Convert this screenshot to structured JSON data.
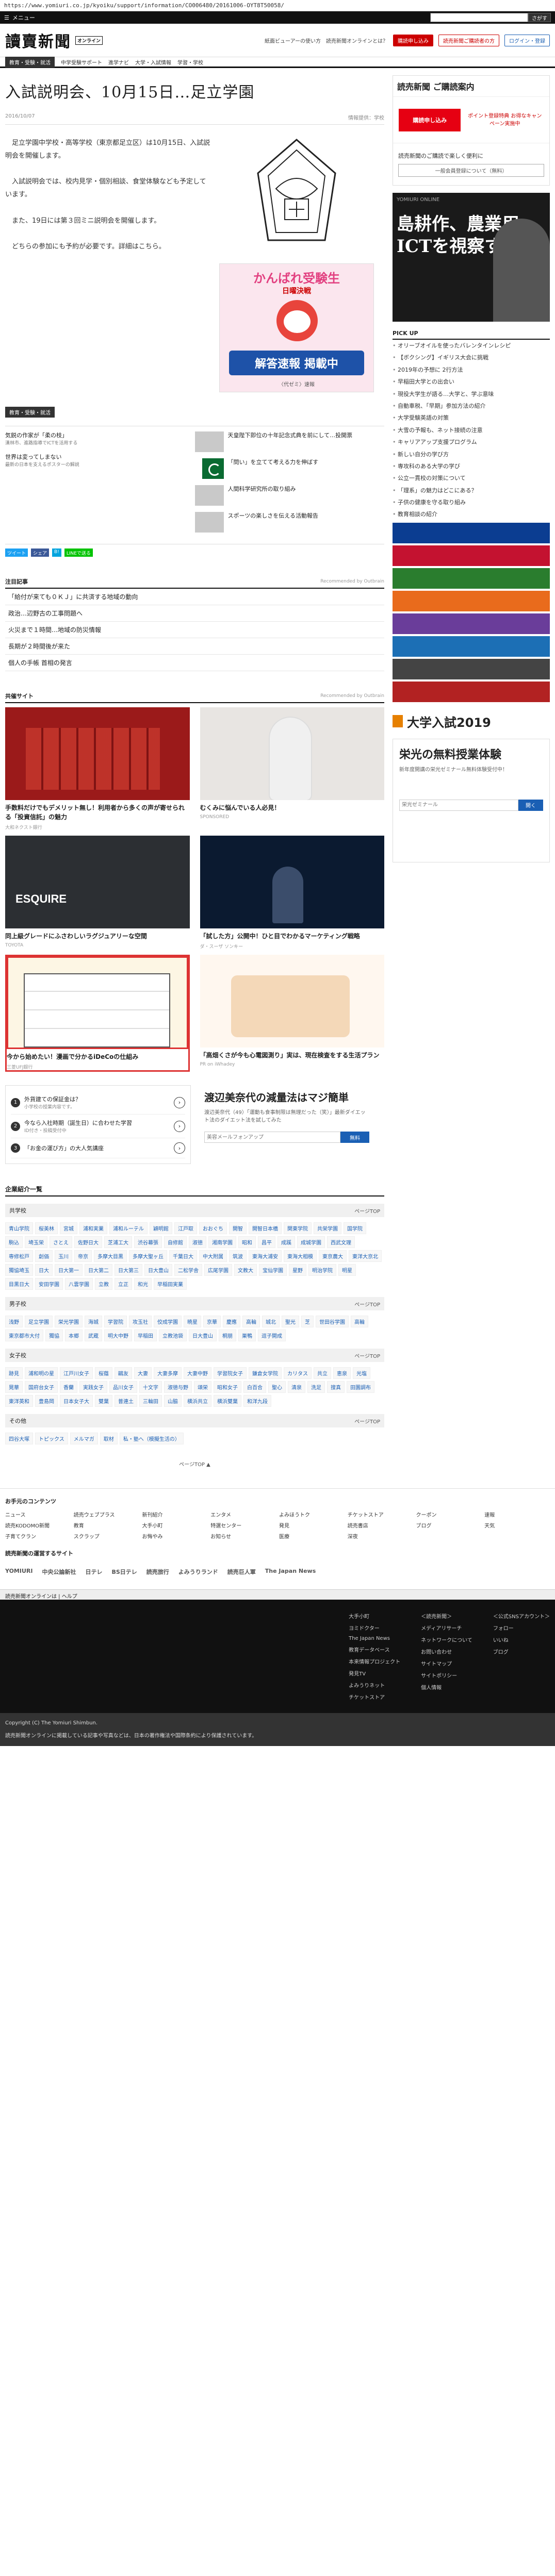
{
  "browser": {
    "url": "https://www.yomiuri.co.jp/kyoiku/support/information/CO006480/20161006-OYT8T50058/"
  },
  "topbar": {
    "menu_label": "メニュー",
    "search_placeholder": "",
    "search_button": "さがす"
  },
  "header": {
    "logo": "讀賣新聞",
    "logo_badge": "オンライン",
    "links": [
      "紙面ビューアーの使い方",
      "読売新聞オンラインとは？"
    ],
    "subscribe_button": "購読申し込み",
    "register_button": "読売新聞ご購読者の方",
    "login_button": "ログイン・登録"
  },
  "catnav": {
    "items": [
      "教育・受験・就活",
      "中学受験サポート",
      "進学ナビ",
      "大学・入試情報",
      "学習・学校"
    ],
    "active": 0
  },
  "article": {
    "title": "入試説明会、10月15日…足立学園",
    "date": "2016/10/07",
    "tools": "情報提供：学校",
    "paragraphs": [
      "足立学園中学校・高等学校（東京都足立区）は10月15日、入試説明会を開催します。",
      "入試説明会では、校内見学・個別相談、食堂体験なども予定しています。",
      "また、19日には第３回ミニ説明会を開催します。",
      "どちらの参加にも予約が必要です。詳細はこちら。"
    ],
    "link_text": "こちら",
    "tag": "教育・受験・就活"
  },
  "ad_kanbare": {
    "title": "かんばれ受験生",
    "sub": "日曜決戦",
    "badge": "解答速報 掲載中",
    "note": "〈代ゼミ〉速報"
  },
  "related": {
    "left": [
      {
        "title": "気鋭の作家が「柔の枝」",
        "small": "漢林市、進路指導でICTを活用する"
      },
      {
        "title": "世界は変ってしまない",
        "small": "最新の日本を支えるポスターの解説"
      }
    ],
    "right": [
      {
        "title": "天皇陛下即位の十年記念式典を前にして…投開票"
      },
      {
        "title": "「問い」を立てて考える力を伸ばす"
      },
      {
        "title": "人間科学研究所の取り組み"
      },
      {
        "title": "スポーツの楽しさを伝える活動報告"
      }
    ]
  },
  "shares": [
    "ツイート",
    "シェア",
    "B!",
    "LINEで送る"
  ],
  "noteworthy": {
    "heading": "注目記事",
    "sub": "Recommended by Outbrain",
    "items": [
      "「給付が来ても０ＫＪ」に共済する地域の動向",
      "政治…辺野古の工事問題へ",
      "火災まで１時間…地域の防災情報",
      "長期が２時間後が来た",
      "個人の手帳 首相の発言"
    ]
  },
  "sponsored": {
    "heading": "共催サイト",
    "sub": "Recommended by Outbrain",
    "cards": [
      {
        "cap": "手数料だけでもデメリット無し！利用者から多くの声が寄せられる「投資信託」の魅力",
        "src": "大和ネクスト銀行"
      },
      {
        "cap": "むくみに悩んでいる人必見！",
        "src": "SPONSORED"
      },
      {
        "cap": "同上級グレードにふさわしいラグジュアリーな空間",
        "src": "TOYOTA"
      },
      {
        "cap": "「試した方」公開中！ひと目でわかるマーケティング戦略",
        "src": "ダ・スーザ ソンキー"
      },
      {
        "cap": "今から始めたい！漫画で分かるiDeCoの仕組み",
        "src": "三菱UFJ銀行"
      },
      {
        "cap": "「高畑くさが今も心電図測り」実は、現在検査をする生活プラン",
        "src": "PR on iWhadey"
      }
    ]
  },
  "quiz": {
    "items": [
      {
        "q": "外貨建ての保証金は？",
        "note": "小学校の授業内容です。"
      },
      {
        "q": "今なら入社時期（誕生日）に合わせた学習",
        "note": "ID付き・投稿受付中"
      },
      {
        "q": "「お金の運び方」の大人気講座",
        "note": ""
      }
    ]
  },
  "magazine": {
    "title": "渡辺美奈代の減量法はマジ簡単",
    "desc": "渡辺美奈代（49）「運動も食事制限は無理だった（笑）」最新ダイエット法のダイエット法を試してみた",
    "placeholder": "美容メールフォンアップ",
    "button": "無料"
  },
  "enterprise": {
    "heading": "企業紹介一覧",
    "groups": [
      {
        "title": "共学校",
        "more": "ページTOP",
        "items": [
          "青山学院",
          "桜美林",
          "宮城",
          "浦和実業",
          "浦和ルーテル",
          "穎明館",
          "江戸取",
          "おおぐち",
          "開智",
          "開智日本橋",
          "関東学院",
          "共栄学園",
          "国学院",
          "駒込",
          "埼玉栄",
          "さとえ",
          "佐野日大",
          "芝浦工大",
          "渋谷幕張",
          "自修館",
          "淑徳",
          "湘南学園",
          "昭和",
          "昌平",
          "成蹊",
          "成城学園",
          "西武文理",
          "専修松戸",
          "創価",
          "玉川",
          "帝京",
          "多摩大目黒",
          "多摩大聖ヶ丘",
          "千葉日大",
          "中大附属",
          "筑波",
          "東海大浦安",
          "東海大相模",
          "東京農大",
          "東洋大京北",
          "獨協埼玉",
          "日大",
          "日大第一",
          "日大第二",
          "日大第三",
          "日大豊山",
          "二松学舎",
          "広尾学園",
          "文教大",
          "宝仙学園",
          "星野",
          "明治学院",
          "明星",
          "目黒日大",
          "安田学園",
          "八雲学園",
          "立教",
          "立正",
          "和光",
          "早稲田実業"
        ]
      },
      {
        "title": "男子校",
        "more": "ページTOP",
        "items": [
          "浅野",
          "足立学園",
          "栄光学園",
          "海城",
          "学習院",
          "攻玉社",
          "佼成学園",
          "暁星",
          "京華",
          "慶應",
          "高輪",
          "城北",
          "聖光",
          "芝",
          "世田谷学園",
          "高輪",
          "東京都市大付",
          "獨協",
          "本郷",
          "武蔵",
          "明大中野",
          "早稲田",
          "立教池袋",
          "日大豊山",
          "桐朋",
          "巣鴨",
          "逗子開成"
        ]
      },
      {
        "title": "女子校",
        "more": "ページTOP",
        "items": [
          "跡見",
          "浦和明の星",
          "江戸川女子",
          "桜蔭",
          "鷗友",
          "大妻",
          "大妻多摩",
          "大妻中野",
          "学習院女子",
          "鎌倉女学院",
          "カリタス",
          "共立",
          "恵泉",
          "光塩",
          "晃華",
          "国府台女子",
          "香蘭",
          "実践女子",
          "品川女子",
          "十文字",
          "淑徳与野",
          "頌栄",
          "昭和女子",
          "白百合",
          "聖心",
          "清泉",
          "洗足",
          "搜真",
          "田園調布",
          "東洋英和",
          "豊島岡",
          "日本女子大",
          "雙葉",
          "普連土",
          "三輪田",
          "山脇",
          "横浜共立",
          "横浜雙葉",
          "和洋九段"
        ]
      },
      {
        "title": "その他",
        "more": "ページTOP",
        "items": [
          "四谷大塚",
          "トピックス",
          "メルマガ",
          "取材",
          "私・塾へ（模擬生活の）"
        ]
      }
    ]
  },
  "pagetop": "ページTOP ▲",
  "side": {
    "reg_title": "読売新聞 ご購読案内",
    "reg_btn1": "購読申し込み",
    "reg_btn2": "ポイント登録特典 お得なキャンペーン実施中",
    "sub_text": "読売新聞のご購読で楽しく便利に",
    "sub_pill": "一般会員登録について（無料）",
    "ad_big": "島耕作、農業用ICTを視察する",
    "ad_small": "YOMIURI ONLINE",
    "pickup_title": "PICK UP",
    "pickup": [
      "オリーブオイルを使ったバレンタインレシピ",
      "【ボクシング】イギリス大会に挑戦",
      "2019年の予想に 2行方法",
      "早稲田大学との出会い",
      "現役大学生が語る…大学と、学ぶ意味",
      "自動車税、「早期」参加方法の紹介",
      "大学受験英語の対策",
      "大雪の予報も、ネット接続の注意",
      "キャリアアップ支援プログラム",
      "新しい自分の学び方",
      "専攻科のある大学の学び",
      "公立一貫校の対策について",
      "「理系」の魅力はどこにある？",
      "子供の健康を守る取り組み",
      "教育相談の紹介"
    ],
    "exam": "大学入試2019",
    "ad_white_title": "栄光の無料授業体験",
    "ad_white_desc": "新年度開講の栄光ゼミナール無料体験受付中！",
    "ad_white_placeholder": "栄光ゼミナール",
    "ad_white_button": "開く"
  },
  "footer": {
    "contents_title": "お手元のコンテンツ",
    "contents": [
      "ニュース",
      "読売ウェブプラス",
      "新刊紹介",
      "エンタメ",
      "よみほうトク",
      "チケットストア",
      "クーポン",
      "速報",
      "読売KODOMO新聞",
      "教育",
      "大手小町",
      "特選センター",
      "発見",
      "読売書店",
      "ブログ",
      "天気",
      "子育てクラン",
      "スクラップ",
      "お悔やみ",
      "お知らせ",
      "医療",
      "深夜"
    ],
    "group_title": "読売新聞の運営するサイト",
    "group_logos": [
      "YOMIURI",
      "中央公論新社",
      "日テレ",
      "BS日テレ",
      "読売旅行",
      "よみうりランド",
      "読売巨人軍",
      "The Japan News"
    ],
    "dark_cols": [
      [
        "大手小町",
        "ヨミドクター",
        "The Japan News",
        "教育データベース",
        "本来情報プロジェクト",
        "発見TV",
        "よみうりネット",
        "チケットストア"
      ],
      [
        "＜読売新聞＞",
        "メディアリサーチ",
        "ネットワークについて",
        "お問い合わせ",
        "サイトマップ",
        "サイトポリシー",
        "個人情報"
      ],
      [
        "＜公式SNSアカウント＞",
        "フォロー",
        "いいね",
        "ブログ"
      ]
    ],
    "copyright": "Copyright (C) The Yomiuri Shimbun.",
    "notice": "読売新聞オンラインに掲載している記事や写真などは、日本の著作権法や国際条約により保護されています。"
  },
  "bottombar": "読売新聞オンラインは | ヘルプ"
}
